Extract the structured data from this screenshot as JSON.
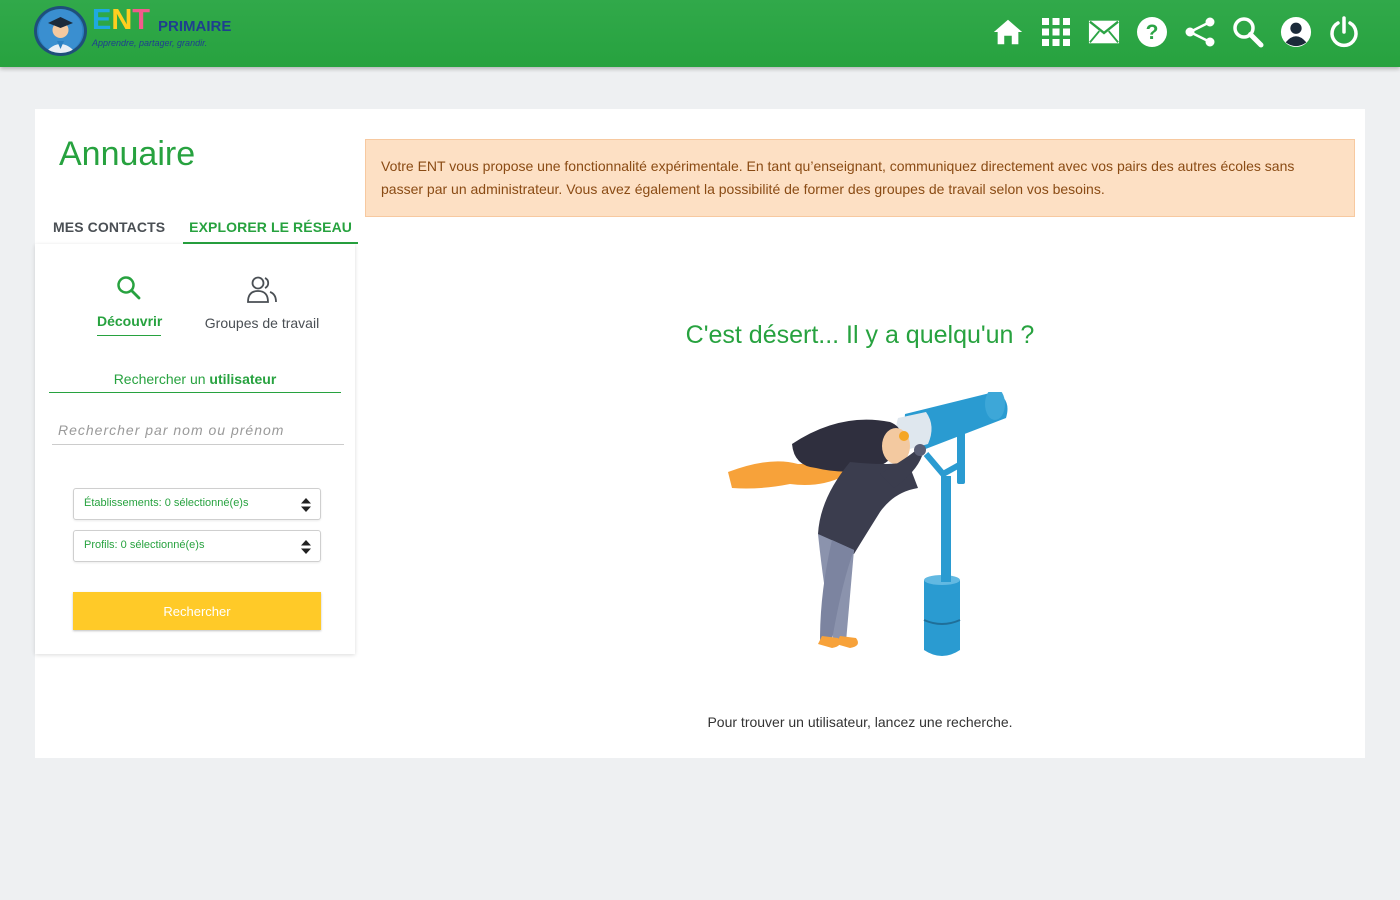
{
  "header": {
    "logo": {
      "word": "ENT",
      "subword": "PRIMAIRE",
      "tagline": "Apprendre, partager, grandir."
    },
    "nav_icons": [
      "home-icon",
      "apps-grid-icon",
      "mail-icon",
      "help-icon",
      "share-icon",
      "search-icon",
      "account-icon",
      "power-icon"
    ],
    "accent": "#27a23f"
  },
  "page": {
    "title": "Annuaire",
    "tabs": [
      {
        "label": "MES CONTACTS",
        "active": false
      },
      {
        "label": "EXPLORER LE RÉSEAU",
        "active": true
      }
    ]
  },
  "sidebar": {
    "modes": [
      {
        "label": "Découvrir",
        "icon": "search-icon",
        "active": true
      },
      {
        "label": "Groupes de travail",
        "icon": "users-icon",
        "active": false
      }
    ],
    "search_title_prefix": "Rechercher un",
    "search_title_bold": "utilisateur",
    "name_placeholder": "Rechercher par nom ou prénom",
    "etablissements_select": "Établissements: 0 sélectionné(e)s",
    "profils_select": "Profils: 0 sélectionné(e)s",
    "search_button": "Rechercher"
  },
  "content": {
    "alert_text": "Votre ENT vous propose une fonctionnalité expérimentale. En tant qu’enseignant, communiquez directement avec vos pairs des autres écoles sans passer par un administrateur. Vous avez également la possibilité de former des groupes de travail selon vos besoins.",
    "empty_title": "C'est désert... Il y a quelqu'un ?",
    "empty_subtitle": "Pour trouver un utilisateur, lancez une recherche."
  }
}
